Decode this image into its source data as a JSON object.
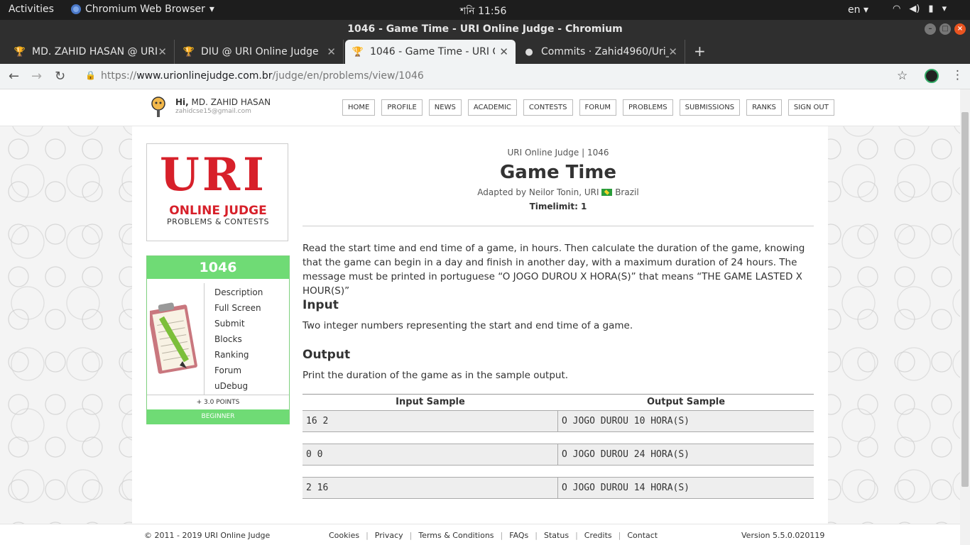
{
  "os": {
    "activities": "Activities",
    "app_menu": "Chromium Web Browser",
    "clock": "শনি 11:56",
    "lang": "en"
  },
  "window": {
    "title": "1046 - Game Time - URI Online Judge - Chromium"
  },
  "tabs": [
    {
      "label": "MD. ZAHID HASAN @ URI",
      "icon": "trophy-icon"
    },
    {
      "label": "DIU @ URI Online Judge",
      "icon": "trophy-icon"
    },
    {
      "label": "1046 - Game Time - URI Onl",
      "icon": "trophy-icon"
    },
    {
      "label": "Commits · Zahid4960/Uri_",
      "icon": "github-icon"
    }
  ],
  "address": {
    "scheme": "https://",
    "host": "www.urionlinejudge.com.br",
    "path": "/judge/en/problems/view/1046"
  },
  "user": {
    "greeting": "Hi,",
    "name": "MD. ZAHID HASAN",
    "email": "zahidcse15@gmail.com"
  },
  "menu": [
    "HOME",
    "PROFILE",
    "NEWS",
    "ACADEMIC",
    "CONTESTS",
    "FORUM",
    "PROBLEMS",
    "SUBMISSIONS",
    "RANKS",
    "SIGN OUT"
  ],
  "logo": {
    "main": "URI",
    "line1": "ONLINE JUDGE",
    "line2": "PROBLEMS & CONTESTS"
  },
  "problem_card": {
    "id": "1046",
    "links": [
      "Description",
      "Full Screen",
      "Submit",
      "Blocks",
      "Ranking",
      "Forum",
      "uDebug"
    ],
    "points": "+ 3.0 POINTS",
    "level": "BEGINNER"
  },
  "problem": {
    "crumb": "URI Online Judge | 1046",
    "title": "Game Time",
    "adapted_by": "Adapted by Neilor Tonin, URI",
    "country": "Brazil",
    "timelimit": "Timelimit: 1",
    "description": "Read the start time and end time of a game, in hours. Then calculate the duration of the game, knowing that the game can begin in a day and finish in another day, with a maximum duration of 24 hours. The message must be printed in portuguese “O JOGO DUROU X HORA(S)” that means “THE GAME LASTED X HOUR(S)”",
    "input_title": "Input",
    "input_text": "Two integer numbers representing the start and end time of a game.",
    "output_title": "Output",
    "output_text": "Print the duration of the game as in the sample output.",
    "samples_header": {
      "input": "Input Sample",
      "output": "Output Sample"
    },
    "samples": [
      {
        "input": "16 2",
        "output": "O JOGO DUROU 10 HORA(S)"
      },
      {
        "input": "0 0",
        "output": "O JOGO DUROU 24 HORA(S)"
      },
      {
        "input": "2 16",
        "output": "O JOGO DUROU 14 HORA(S)"
      }
    ]
  },
  "footer": {
    "copyright": "© 2011 - 2019 URI Online Judge",
    "links": [
      "Cookies",
      "Privacy",
      "Terms & Conditions",
      "FAQs",
      "Status",
      "Credits",
      "Contact"
    ],
    "version": "Version 5.5.0.020119"
  },
  "colors": {
    "accent_green": "#6fdb75",
    "logo_red": "#d7202a",
    "os_orange": "#e95420"
  }
}
